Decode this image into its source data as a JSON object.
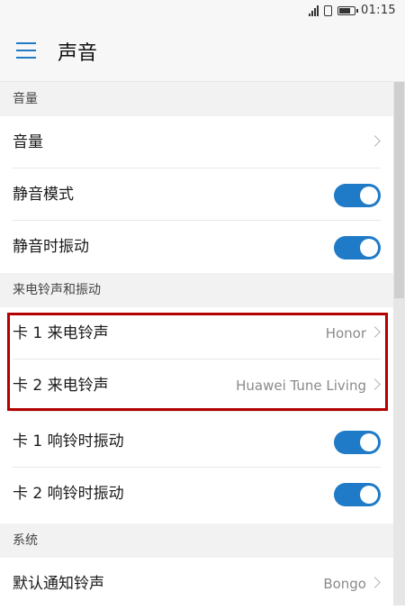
{
  "status": {
    "time": "01:15",
    "icons": [
      "signal-icon",
      "sim-icon",
      "battery-icon"
    ]
  },
  "appbar": {
    "title": "声音",
    "menu_icon": "menu-icon"
  },
  "sections": {
    "volume": {
      "header": "音量",
      "volume_label": "音量",
      "silent_mode_label": "静音模式",
      "vibrate_silent_label": "静音时振动"
    },
    "ringtone": {
      "header": "来电铃声和振动",
      "card1_ringtone_label": "卡 1 来电铃声",
      "card1_ringtone_value": "Honor",
      "card2_ringtone_label": "卡 2 来电铃声",
      "card2_ringtone_value": "Huawei Tune Living",
      "card1_vibrate_label": "卡 1 响铃时振动",
      "card2_vibrate_label": "卡 2 响铃时振动"
    },
    "system": {
      "header": "系统",
      "default_notification_label": "默认通知铃声",
      "default_notification_value": "Bongo"
    }
  },
  "toggles": {
    "silent_mode": true,
    "vibrate_silent": true,
    "card1_vibrate": true,
    "card2_vibrate": true
  },
  "colors": {
    "accent": "#1f7ac7",
    "highlight": "#b30000"
  }
}
